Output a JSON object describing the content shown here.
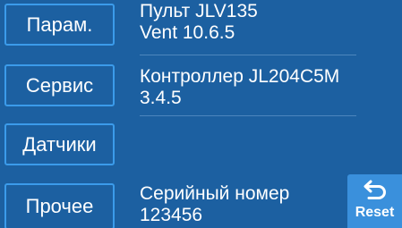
{
  "nav": {
    "params_label": "Парам.",
    "service_label": "Сервис",
    "sensors_label": "Датчики",
    "other_label": "Прочее"
  },
  "info": {
    "remote": {
      "name": "Пульт JLV135",
      "version": "Vent 10.6.5"
    },
    "controller": {
      "name": "Контроллер JL204C5M",
      "version": "3.4.5"
    },
    "serial": {
      "label": "Серийный номер",
      "value": "123456"
    }
  },
  "reset": {
    "label": "Reset",
    "icon": "undo-arrow-icon"
  },
  "colors": {
    "background": "#1c60a1",
    "button_border": "#3b9bea",
    "reset_background": "#3a90dc",
    "text": "#ffffff"
  }
}
